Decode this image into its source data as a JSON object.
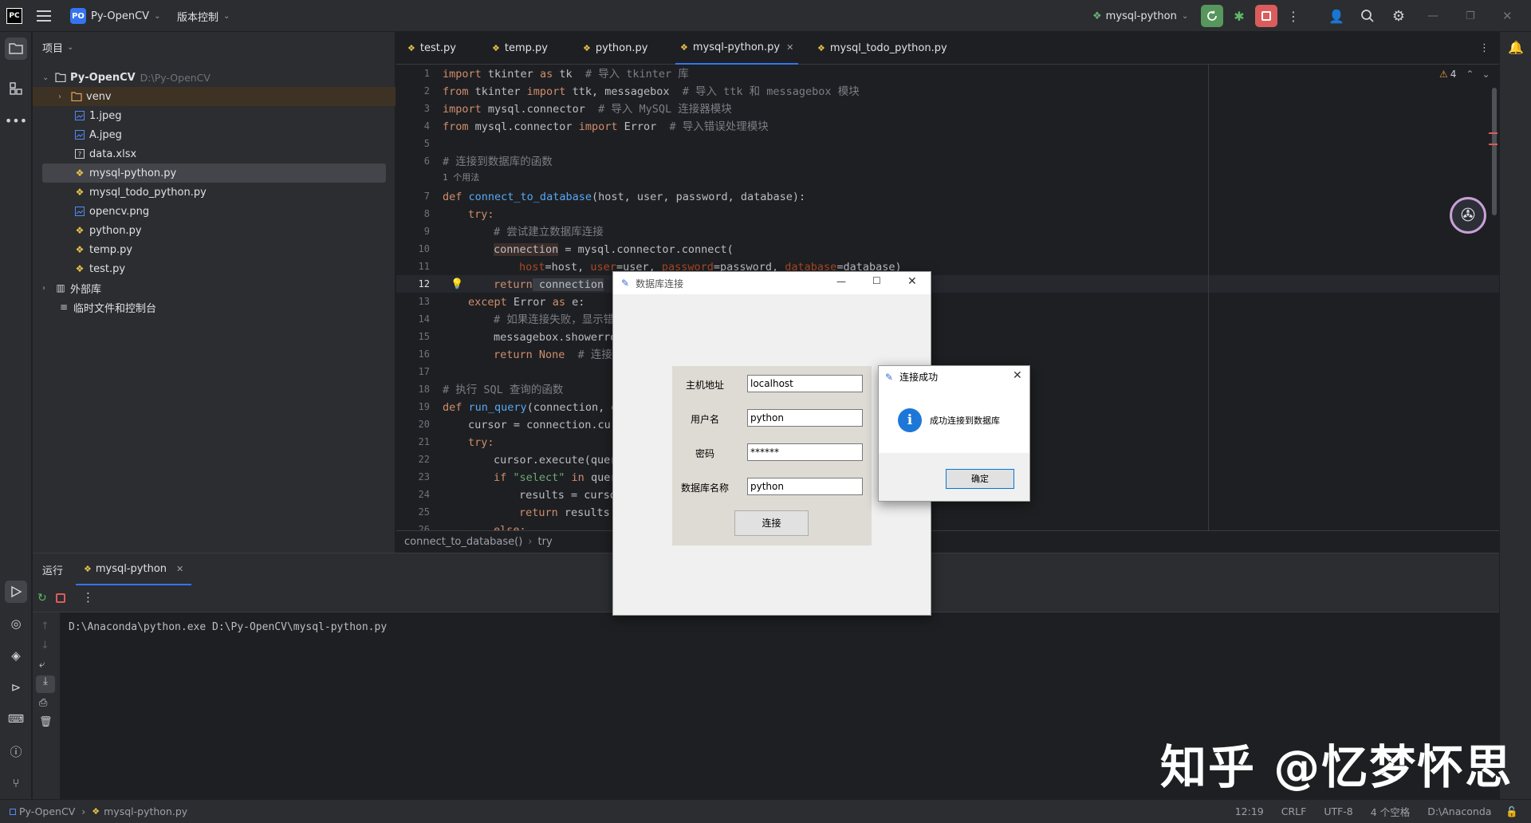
{
  "titlebar": {
    "app_badge": "PC",
    "project_badge": "PO",
    "project_name": "Py-OpenCV",
    "vcs": "版本控制",
    "run_config": "mysql-python"
  },
  "left_toolbar": {
    "items": [
      "project-icon",
      "structure-icon",
      "more-icon"
    ],
    "bottom_items": [
      "run-icon",
      "python-console-icon",
      "layers-icon",
      "services-icon",
      "terminal-icon",
      "problems-icon",
      "git-icon"
    ]
  },
  "project_panel": {
    "title": "项目",
    "root": "Py-OpenCV",
    "root_path": "D:\\Py-OpenCV",
    "items": [
      {
        "name": "venv",
        "type": "folder"
      },
      {
        "name": "1.jpeg",
        "type": "image"
      },
      {
        "name": "A.jpeg",
        "type": "image"
      },
      {
        "name": "data.xlsx",
        "type": "file"
      },
      {
        "name": "mysql-python.py",
        "type": "python"
      },
      {
        "name": "mysql_todo_python.py",
        "type": "python"
      },
      {
        "name": "opencv.png",
        "type": "image"
      },
      {
        "name": "python.py",
        "type": "python"
      },
      {
        "name": "temp.py",
        "type": "python"
      },
      {
        "name": "test.py",
        "type": "python"
      }
    ],
    "external": "外部库",
    "scratch": "临时文件和控制台"
  },
  "tabs": [
    {
      "label": "test.py"
    },
    {
      "label": "temp.py"
    },
    {
      "label": "python.py"
    },
    {
      "label": "mysql-python.py",
      "active": true
    },
    {
      "label": "mysql_todo_python.py"
    }
  ],
  "editor": {
    "warnings": "4",
    "line_numbers": [
      "1",
      "2",
      "3",
      "4",
      "5",
      "6",
      "7",
      "8",
      "9",
      "10",
      "11",
      "12",
      "13",
      "14",
      "15",
      "16",
      "17",
      "18",
      "19",
      "20",
      "21",
      "22",
      "23",
      "24",
      "25",
      "26"
    ],
    "usage_hint": "1 个用法",
    "lines": {
      "l1a": "import",
      "l1b": " tkinter ",
      "l1c": "as",
      "l1d": " tk  ",
      "l1e": "# 导入 tkinter 库",
      "l2a": "from",
      "l2b": " tkinter ",
      "l2c": "import",
      "l2d": " ttk, messagebox  ",
      "l2e": "# 导入 ttk 和 messagebox 模块",
      "l3a": "import",
      "l3b": " mysql.connector  ",
      "l3c": "# 导入 MySQL 连接器模块",
      "l4a": "from",
      "l4b": " mysql.connector ",
      "l4c": "import",
      "l4d": " Error  ",
      "l4e": "# 导入错误处理模块",
      "l6": "# 连接到数据库的函数",
      "l7a": "def",
      "l7b": "connect_to_database",
      "l7c": "(host, user, password, database):",
      "l8": "try:",
      "l9": "# 尝试建立数据库连接",
      "l10a": "connection",
      "l10b": " = mysql.connector.connect(",
      "l11a": "host",
      "l11b": "=host, ",
      "l11c": "user",
      "l11d": "=user, ",
      "l11e": "password",
      "l11f": "=password, ",
      "l11g": "database",
      "l11h": "=database)",
      "l12a": "return",
      "l12b": " connection",
      "l13a": "except",
      "l13b": " Error ",
      "l13c": "as",
      "l13d": " e:",
      "l14": "# 如果连接失败，显示错",
      "l15": "messagebox.showerro",
      "l16a": "return",
      "l16b": " None",
      "l16c": "  # 连接",
      "l18": "# 执行 SQL 查询的函数",
      "l19a": "def",
      "l19b": "run_query",
      "l19c": "(connection, q",
      "l20": "cursor = connection.cur",
      "l21": "try:",
      "l22": "cursor.execute(quer",
      "l23a": "if",
      "l23b": " \"select\"",
      "l23c": " in",
      "l23d": " quer",
      "l24": "results = curso",
      "l25a": "return",
      "l25b": " results",
      "l26a": "else:"
    }
  },
  "breadcrumb": {
    "func": "connect_to_database()",
    "part": "try"
  },
  "run_panel": {
    "title": "运行",
    "tab": "mysql-python",
    "command": "D:\\Anaconda\\python.exe D:\\Py-OpenCV\\mysql-python.py"
  },
  "statusbar": {
    "project": "Py-OpenCV",
    "file": "mysql-python.py",
    "position": "12:19",
    "line_sep": "CRLF",
    "encoding": "UTF-8",
    "indent": "4 个空格",
    "interpreter": "D:\\Anaconda"
  },
  "dialog_db": {
    "title": "数据库连接",
    "labels": [
      "主机地址",
      "用户名",
      "密码",
      "数据库名称"
    ],
    "values": [
      "localhost",
      "python",
      "******",
      "python"
    ],
    "connect_button": "连接"
  },
  "dialog_success": {
    "title": "连接成功",
    "message": "成功连接到数据库",
    "ok_button": "确定"
  },
  "watermark": "知乎 @忆梦怀思",
  "colors": {
    "bg": "#1e1f22",
    "panel": "#2b2d30",
    "accent": "#3574f0",
    "keyword": "#cf8e6d",
    "function": "#56a8f5",
    "comment": "#7a7e85"
  }
}
